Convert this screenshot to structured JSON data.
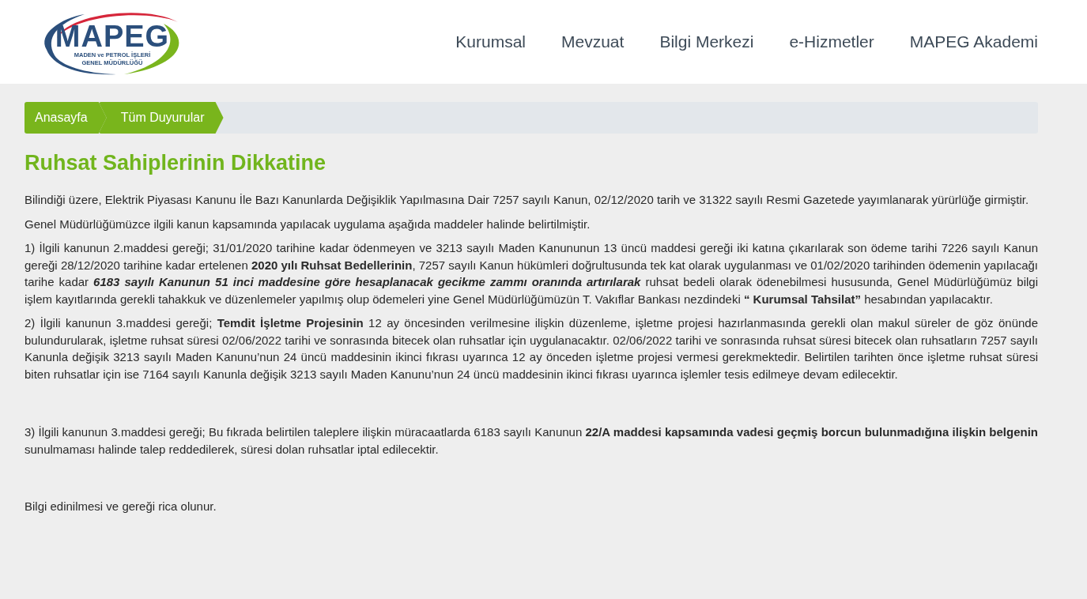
{
  "logo": {
    "wordmark": "MAPEG",
    "line_1": "MADEN ve PETROL İŞLERİ",
    "line_2": "GENEL MÜDÜRLÜĞÜ"
  },
  "nav": [
    "Kurumsal",
    "Mevzuat",
    "Bilgi Merkezi",
    "e-Hizmetler",
    "MAPEG Akademi"
  ],
  "breadcrumb": [
    "Anasayfa",
    "Tüm Duyurular"
  ],
  "title": "Ruhsat Sahiplerinin Dikkatine",
  "paragraphs": [
    "Bilindiği üzere, Elektrik Piyasası Kanunu İle Bazı Kanunlarda Değişiklik Yapılmasına Dair 7257 sayılı Kanun, 02/12/2020 tarih ve 31322 sayılı Resmi Gazetede yayımlanarak yürürlüğe girmiştir.",
    "Genel Müdürlüğümüzce ilgili kanun kapsamında yapılacak uygulama aşağıda maddeler halinde belirtilmiştir.",
    "1) İlgili kanunun 2.maddesi gereği; 31/01/2020 tarihine kadar ödenmeyen ve 3213 sayılı Maden Kanununun 13 üncü maddesi gereği iki katına çıkarılarak son ödeme tarihi 7226 sayılı Kanun gereği  28/12/2020 tarihine kadar ertelenen **2020 yılı Ruhsat Bedellerinin**, 7257 sayılı Kanun hükümleri doğrultusunda tek kat olarak uygulanması ve 01/02/2020 tarihinden ödemenin yapılacağı tarihe kadar *6183 sayılı Kanunun 51 inci maddesine göre hesaplanacak gecikme zammı oranında artırılarak* ruhsat bedeli olarak ödenebilmesi hususunda, Genel Müdürlüğümüz bilgi işlem kayıtlarında gerekli tahakkuk ve düzenlemeler yapılmış olup ödemeleri yine Genel Müdürlüğümüzün T. Vakıflar Bankası nezdindeki **“ Kurumsal Tahsilat”** hesabından yapılacaktır.",
    "2) İlgili kanunun 3.maddesi gereği; **Temdit İşletme Projesinin** 12 ay öncesinden verilmesine ilişkin düzenleme, işletme projesi hazırlanmasında gerekli olan makul süreler de göz önünde bulundurularak, işletme ruhsat süresi 02/06/2022 tarihi ve sonrasında bitecek olan ruhsatlar için uygulanacaktır. 02/06/2022 tarihi ve sonrasında ruhsat süresi bitecek olan ruhsatların 7257 sayılı Kanunla değişik 3213 sayılı Maden Kanunu’nun 24 üncü maddesinin ikinci fıkrası uyarınca 12 ay önceden işletme projesi vermesi gerekmektedir. Belirtilen tarihten önce işletme ruhsat süresi biten ruhsatlar için ise 7164 sayılı Kanunla değişik 3213 sayılı Maden Kanunu’nun 24 üncü maddesinin ikinci fıkrası uyarınca işlemler tesis edilmeye devam edilecektir.",
    " 3) İlgili kanunun 3.maddesi gereği; Bu fıkrada belirtilen taleplere ilişkin müracaatlarda 6183 sayılı Kanunun **22/A maddesi kapsamında vadesi geçmiş borcun bulunmadığına ilişkin belgenin** sunulmaması halinde talep reddedilerek, süresi dolan ruhsatlar iptal edilecektir.",
    "Bilgi edinilmesi ve gereği rica olunur."
  ]
}
